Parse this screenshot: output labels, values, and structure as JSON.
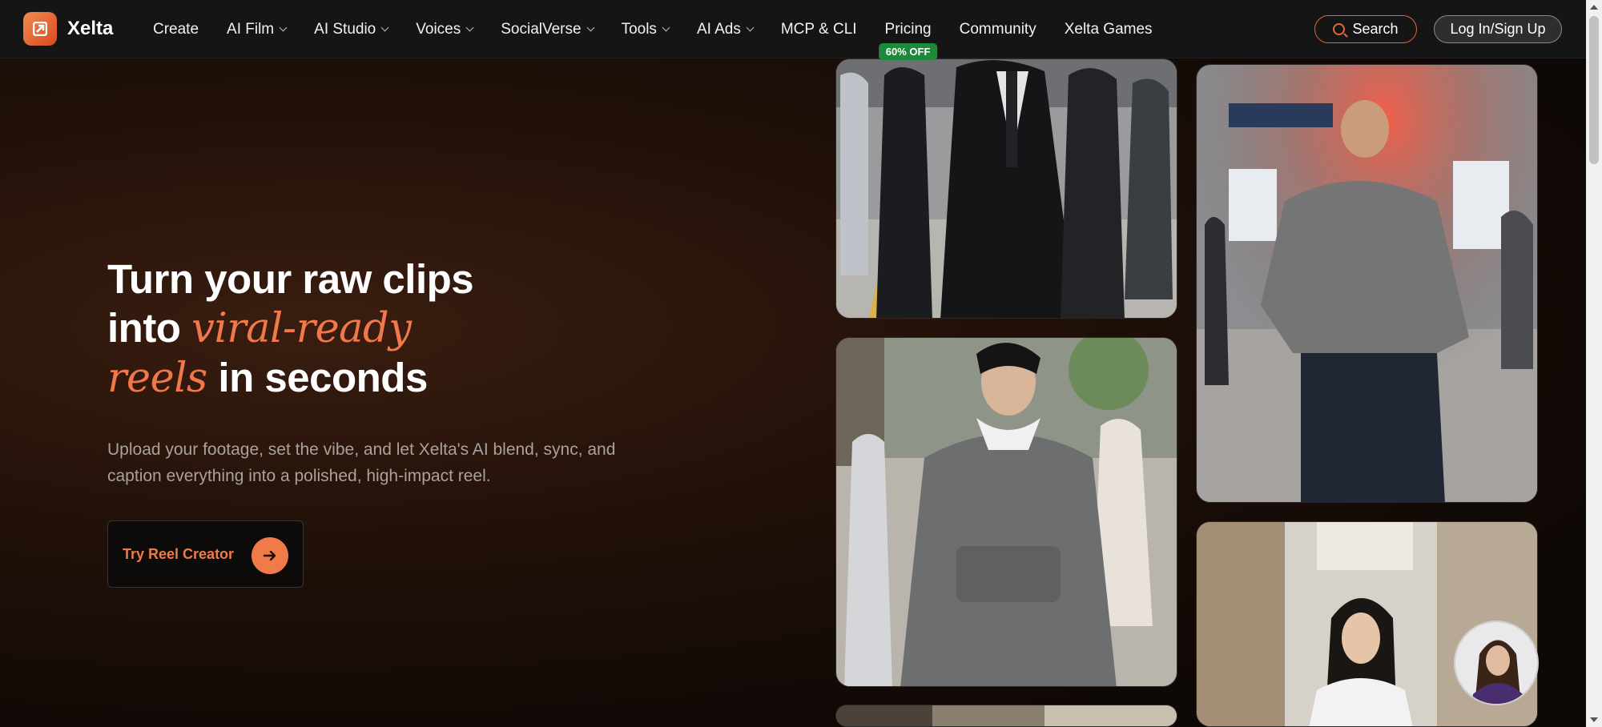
{
  "nav": {
    "brand": "Xelta",
    "items": [
      {
        "label": "Create",
        "dropdown": false
      },
      {
        "label": "AI Film",
        "dropdown": true
      },
      {
        "label": "AI Studio",
        "dropdown": true
      },
      {
        "label": "Voices",
        "dropdown": true
      },
      {
        "label": "SocialVerse",
        "dropdown": true
      },
      {
        "label": "Tools",
        "dropdown": true
      },
      {
        "label": "AI Ads",
        "dropdown": true
      },
      {
        "label": "MCP & CLI",
        "dropdown": false
      },
      {
        "label": "Pricing",
        "dropdown": false,
        "badge": "60% OFF"
      },
      {
        "label": "Community",
        "dropdown": false
      },
      {
        "label": "Xelta Games",
        "dropdown": false
      }
    ],
    "search_label": "Search",
    "login_label": "Log In/Sign Up"
  },
  "hero": {
    "line1": "Turn your raw clips",
    "line2_plain": "into",
    "line2_accent": "viral-ready",
    "line3_accent": "reels",
    "line3_plain": "in seconds",
    "subtitle": "Upload your footage, set the vibe, and let Xelta's AI blend, sync, and caption everything into a polished, high-impact reel.",
    "cta_label": "Try Reel Creator"
  },
  "colors": {
    "accent": "#f07a48",
    "badge": "#1c8a3a",
    "background": "#0c0a09"
  }
}
